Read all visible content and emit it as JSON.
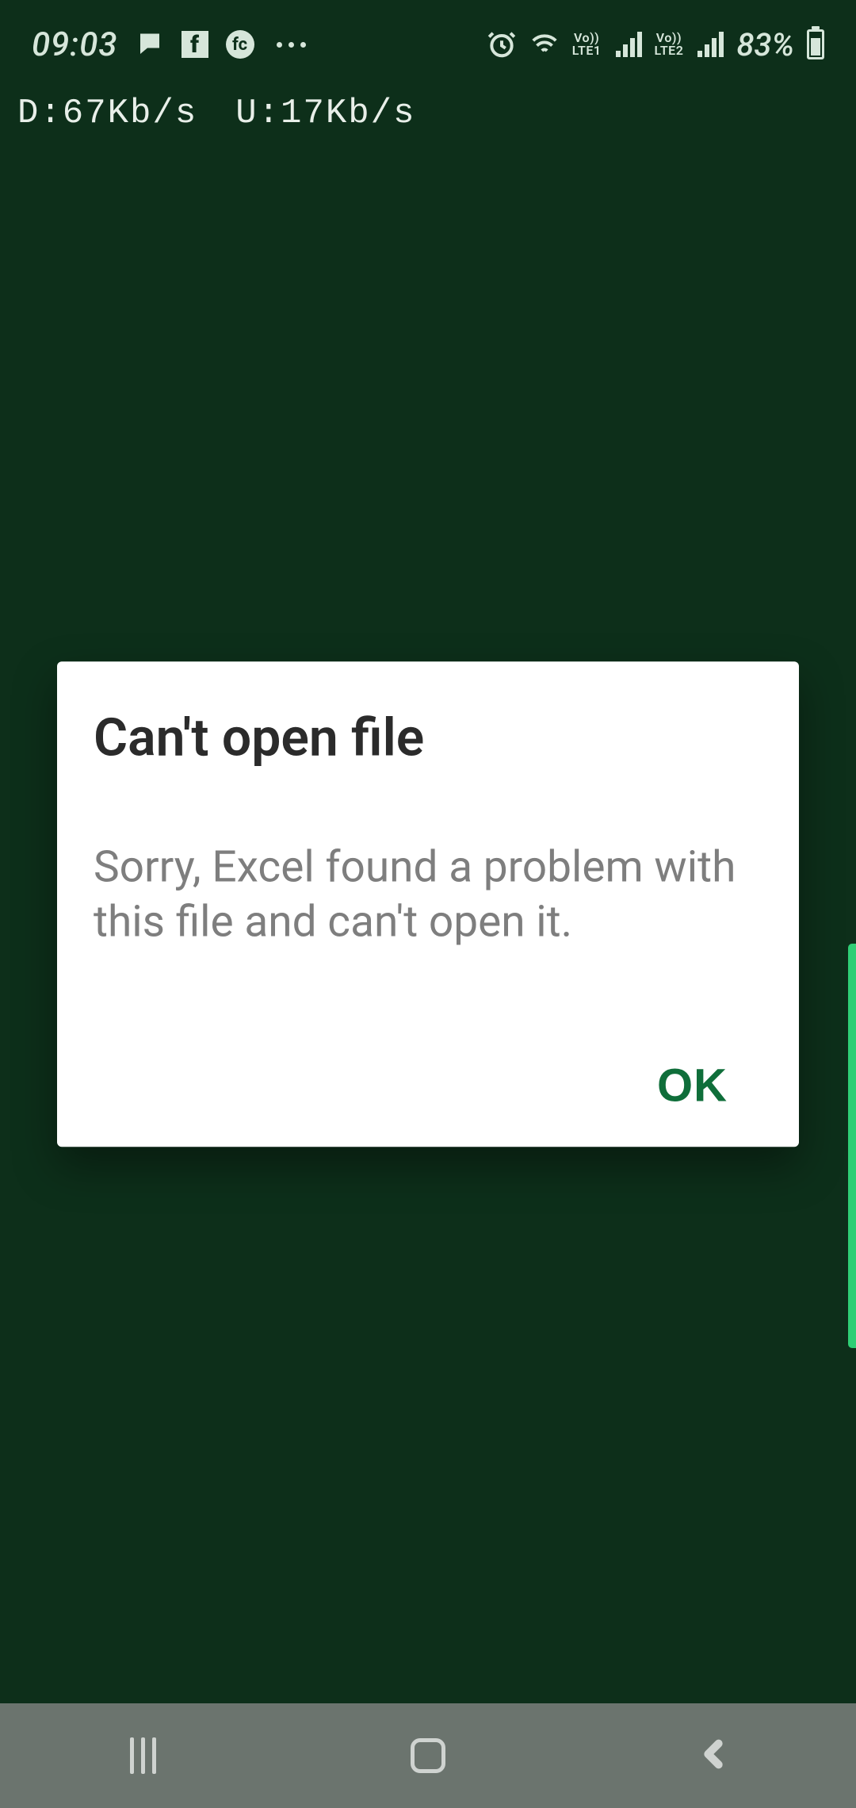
{
  "status_bar": {
    "time": "09:03",
    "icons": {
      "chat": "chat-icon",
      "facebook": "f",
      "fc": "fc",
      "more_dots": 3,
      "alarm": "alarm-icon",
      "wifi": "wifi-icon"
    },
    "sim1": {
      "top": "Vo))",
      "bottom": "LTE1"
    },
    "sim2": {
      "top": "Vo))",
      "bottom": "LTE2"
    },
    "battery_percent": "83%"
  },
  "net_speed": {
    "down": "D:67Kb/s",
    "up": "U:17Kb/s"
  },
  "dialog": {
    "title": "Can't open file",
    "message": "Sorry, Excel found a problem with this file and can't open it.",
    "ok_label": "OK"
  },
  "nav": {
    "recents": "recents",
    "home": "home",
    "back": "back"
  }
}
